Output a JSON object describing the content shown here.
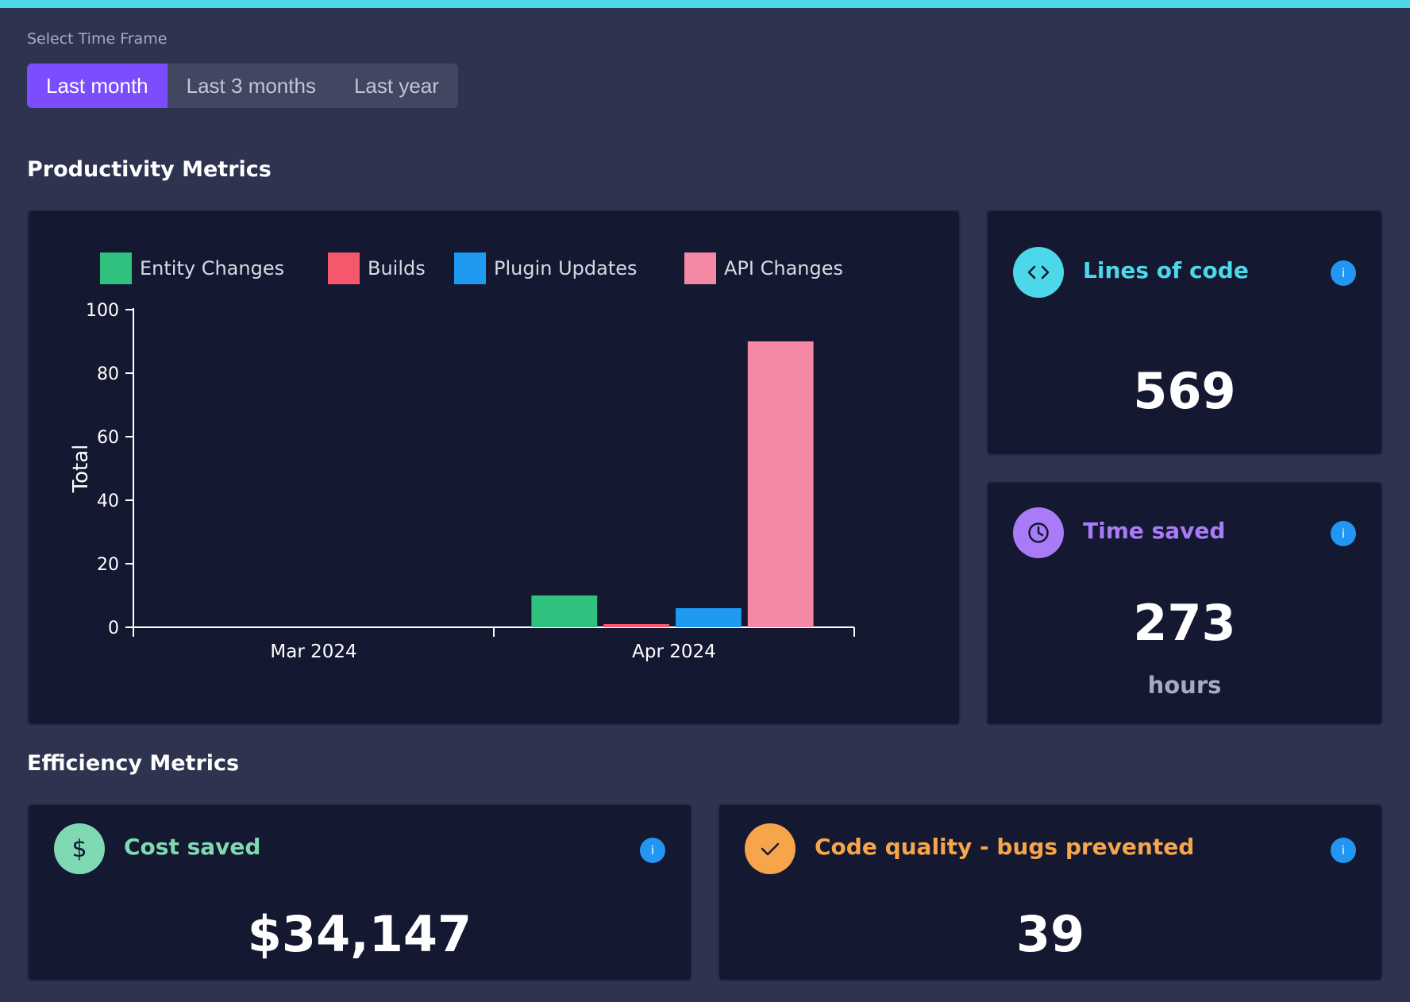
{
  "time_frame": {
    "label": "Select Time Frame",
    "options": [
      "Last month",
      "Last 3 months",
      "Last year"
    ],
    "selected": "Last month"
  },
  "productivity": {
    "title": "Productivity Metrics",
    "lines_of_code": {
      "title": "Lines of code",
      "value": "569",
      "color": "#4dd8ea",
      "icon": "code-icon"
    },
    "time_saved": {
      "title": "Time saved",
      "value": "273",
      "unit": "hours",
      "color": "#a97bf8",
      "icon": "clock-icon"
    }
  },
  "efficiency": {
    "title": "Efficiency Metrics",
    "cost_saved": {
      "title": "Cost saved",
      "value": "$34,147",
      "color": "#7fd9b2",
      "icon": "dollar-icon"
    },
    "code_quality": {
      "title": "Code quality - bugs prevented",
      "value": "39",
      "color": "#f6a54a",
      "icon": "check-icon"
    }
  },
  "info_icon": {
    "glyph": "i",
    "color": "#2196f3"
  },
  "chart_data": {
    "type": "bar",
    "categories": [
      "Mar 2024",
      "Apr 2024"
    ],
    "series": [
      {
        "name": "Entity Changes",
        "color": "#2ec27e",
        "values": [
          0,
          10
        ]
      },
      {
        "name": "Builds",
        "color": "#f5576c",
        "values": [
          0,
          1
        ]
      },
      {
        "name": "Plugin Updates",
        "color": "#1e9bf0",
        "values": [
          0,
          6
        ]
      },
      {
        "name": "API Changes",
        "color": "#f589a5",
        "values": [
          0,
          90
        ]
      }
    ],
    "ylabel": "Total",
    "xlabel": "",
    "ylim": [
      0,
      100
    ],
    "yticks": [
      0,
      20,
      40,
      60,
      80,
      100
    ],
    "legend": "top",
    "grid": false
  }
}
